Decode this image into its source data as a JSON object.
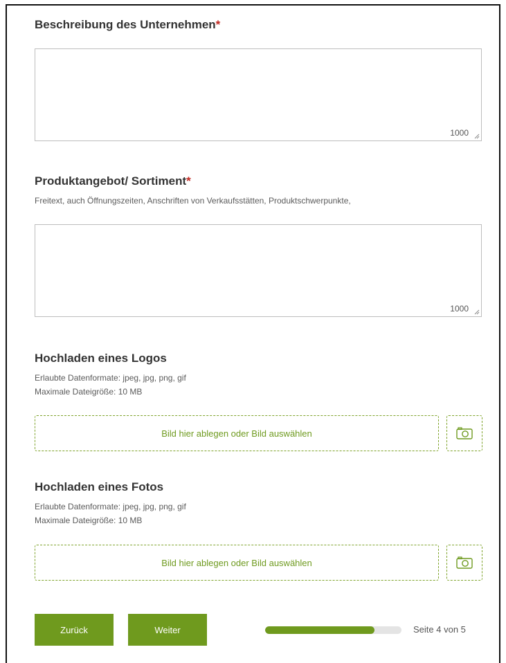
{
  "description": {
    "label": "Beschreibung des Unternehmen",
    "required_mark": "*",
    "value": "",
    "counter": "1000"
  },
  "products": {
    "label": "Produktangebot/ Sortiment",
    "required_mark": "*",
    "hint": "Freitext, auch Öffnungszeiten, Anschriften von Verkaufsstätten, Produktschwerpunkte,",
    "value": "",
    "counter": "1000"
  },
  "logo_upload": {
    "label": "Hochladen eines Logos",
    "formats": "Erlaubte Datenformate: jpeg, jpg, png, gif",
    "max_size": "Maximale Dateigröße: 10 MB",
    "drop_text": "Bild hier ablegen oder Bild auswählen",
    "camera_icon": "camera-icon"
  },
  "photo_upload": {
    "label": "Hochladen eines Fotos",
    "formats": "Erlaubte Datenformate: jpeg, jpg, png, gif",
    "max_size": "Maximale Dateigröße: 10 MB",
    "drop_text": "Bild hier ablegen oder Bild auswählen",
    "camera_icon": "camera-icon"
  },
  "nav": {
    "back_label": "Zurück",
    "next_label": "Weiter",
    "progress_fraction": 0.8,
    "page_text": "Seite 4 von 5"
  },
  "colors": {
    "accent": "#6f9a1e",
    "required": "#c0261f",
    "dashed_border": "#7ea32a"
  }
}
